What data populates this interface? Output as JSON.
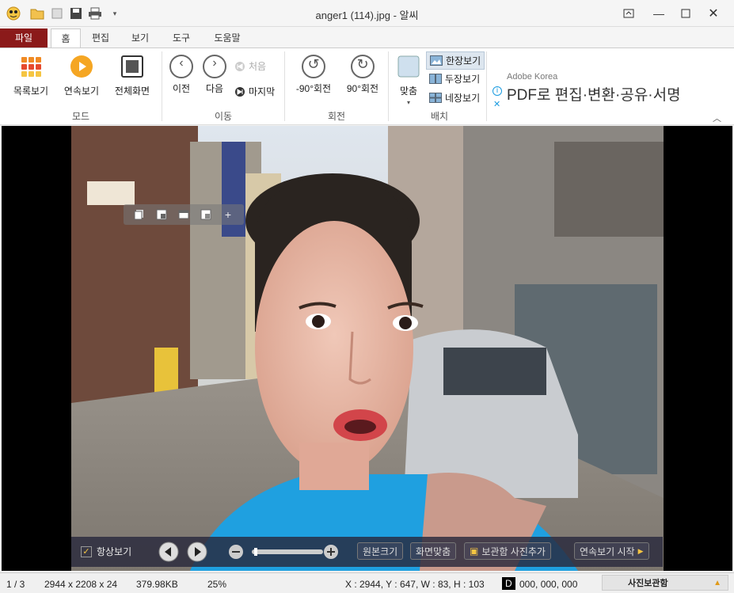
{
  "window": {
    "title": "anger1 (114).jpg - 알씨",
    "minimize_icon": "minimize-icon",
    "maximize_icon": "maximize-icon",
    "close_icon": "close-icon"
  },
  "ribbon_tabs": [
    {
      "label": "파일"
    },
    {
      "label": "홈"
    },
    {
      "label": "편집"
    },
    {
      "label": "보기"
    },
    {
      "label": "도구"
    },
    {
      "label": "도움말"
    }
  ],
  "mode_group": {
    "label": "모드",
    "buttons": [
      {
        "label": "목록보기",
        "icon": "grid-thumbnail-icon"
      },
      {
        "label": "연속보기",
        "icon": "play-icon"
      },
      {
        "label": "전체화면",
        "icon": "fullscreen-icon"
      }
    ]
  },
  "move_group": {
    "label": "이동",
    "prev": "이전",
    "next": "다음",
    "first": "처음",
    "last": "마지막"
  },
  "rotate_group": {
    "label": "회전",
    "ccw": "-90°회전",
    "cw": "90°회전"
  },
  "layout_group": {
    "label": "배치",
    "fit": "맞춤",
    "one": "한장보기",
    "two": "두장보기",
    "four": "네장보기"
  },
  "ad": {
    "brand": "Adobe Korea",
    "text": "PDF로 편집·변환·공유·서명"
  },
  "viewer_bar": {
    "always_show": "항상보기",
    "original_size": "원본크기",
    "fit_screen": "화면맞춤",
    "add_to_box": "보관함 사진추가",
    "slideshow": "연속보기 시작",
    "zoom_level_fraction": 0.03
  },
  "status": {
    "index": "1 / 3",
    "dimensions": "2944 x 2208 x 24",
    "filesize": "379.98KB",
    "zoom": "25%",
    "coords": "X : 2944, Y : 647, W : 83, H : 103",
    "color_label": "D",
    "color_value": "000, 000, 000",
    "photo_box": "사진보관함"
  }
}
